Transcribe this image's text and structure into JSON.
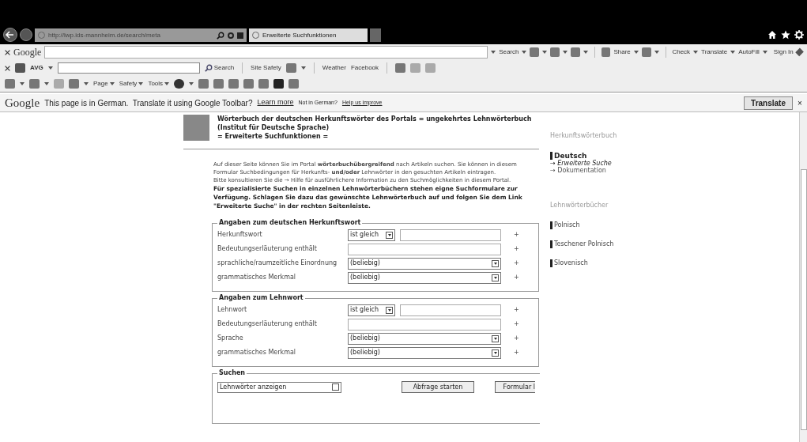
{
  "browser": {
    "address": "http://lwp.ids-mannheim.de/search/meta",
    "tab": "Erweiterte Suchfunktionen"
  },
  "google_toolbar": {
    "logo": "Google",
    "items": [
      "Search",
      "Share",
      "Check",
      "Translate",
      "AutoFill"
    ],
    "sign_in": "Sign In"
  },
  "avg_toolbar": {
    "logo": "AVG",
    "search": "Search",
    "items": [
      "Site Safety",
      "Weather",
      "Facebook"
    ]
  },
  "command_bar": {
    "items": [
      "Page",
      "Safety",
      "Tools"
    ]
  },
  "translate_bar": {
    "logo": "Google",
    "message": "This page is in German.  Translate it using Google Toolbar?",
    "learn_more": "Learn more",
    "not_german": "Not in German?",
    "help": "Help us improve",
    "button": "Translate",
    "close": "×"
  },
  "header": {
    "title": "Wörterbuch der deutschen Herkunftswörter des Portals = ungekehrtes Lehnwörterbuch",
    "subtitle": "(Institut für Deutsche Sprache)",
    "section": "= Erweiterte Suchfunktionen ="
  },
  "intro": [
    "Auf dieser Seite können Sie im Portal **wörterbuchübergreifend** nach Artikeln suchen. Sie können in diesem Formular Suchbedingungen für Herkunfts- **und/oder** Lehnwörter in den gesuchten Artikeln eintragen.",
    "Bitte konsultieren Sie die → Hilfe für ausführlichere Information zu den Suchmöglichkeiten in diesem Portal.",
    "**Für spezialisierte Suchen in einzelnen Lehnwörterbüchern stehen eigne Suchformulare zur Verfügung. Schlagen Sie dazu das gewünschte Lehnwörterbuch auf und folgen Sie dem Link \"Erweiterte Suche\" in der rechten Seitenleiste.**"
  ],
  "fieldsets": [
    {
      "legend": "Angaben zum deutschen Herkunftswort",
      "rows": [
        {
          "kind": "operator",
          "label": "Herkunftswort",
          "operator": "ist gleich",
          "plus": "+"
        },
        {
          "kind": "text",
          "label": "Bedeutungserläuterung enthält",
          "plus": "+"
        },
        {
          "kind": "select",
          "label": "sprachliche/raumzeitliche Einordnung",
          "value": "(beliebig)",
          "plus": "+"
        },
        {
          "kind": "select",
          "label": "grammatisches Merkmal",
          "value": "(beliebig)",
          "plus": "+"
        }
      ]
    },
    {
      "legend": "Angaben zum Lehnwort",
      "rows": [
        {
          "kind": "operator",
          "label": "Lehnwort",
          "operator": "ist gleich",
          "plus": "+"
        },
        {
          "kind": "text",
          "label": "Bedeutungserläuterung enthält",
          "plus": "+"
        },
        {
          "kind": "select",
          "label": "Sprache",
          "value": "(beliebig)",
          "plus": "+"
        },
        {
          "kind": "select",
          "label": "grammatisches Merkmal",
          "value": "(beliebig)",
          "plus": "+"
        }
      ]
    }
  ],
  "search": {
    "legend": "Suchen",
    "select": "Lehnwörter anzeigen",
    "buttons": [
      "Abfrage starten",
      "Formular l"
    ]
  },
  "sidebar": {
    "sections": [
      {
        "heading": "Herkunftswörterbuch",
        "items": [
          {
            "label": "Deutsch",
            "selected": true,
            "links": [
              {
                "arrow": "→",
                "label": "Erweiterte Suche",
                "selected": true
              },
              {
                "arrow": "→",
                "label": "Dokumentation",
                "selected": false
              }
            ]
          }
        ]
      },
      {
        "heading": "Lehnwörterbücher",
        "items": [
          {
            "label": "Polnisch",
            "selected": false
          },
          {
            "label": "Teschener Polnisch",
            "selected": false
          },
          {
            "label": "Slovenisch",
            "selected": false
          }
        ]
      }
    ]
  }
}
